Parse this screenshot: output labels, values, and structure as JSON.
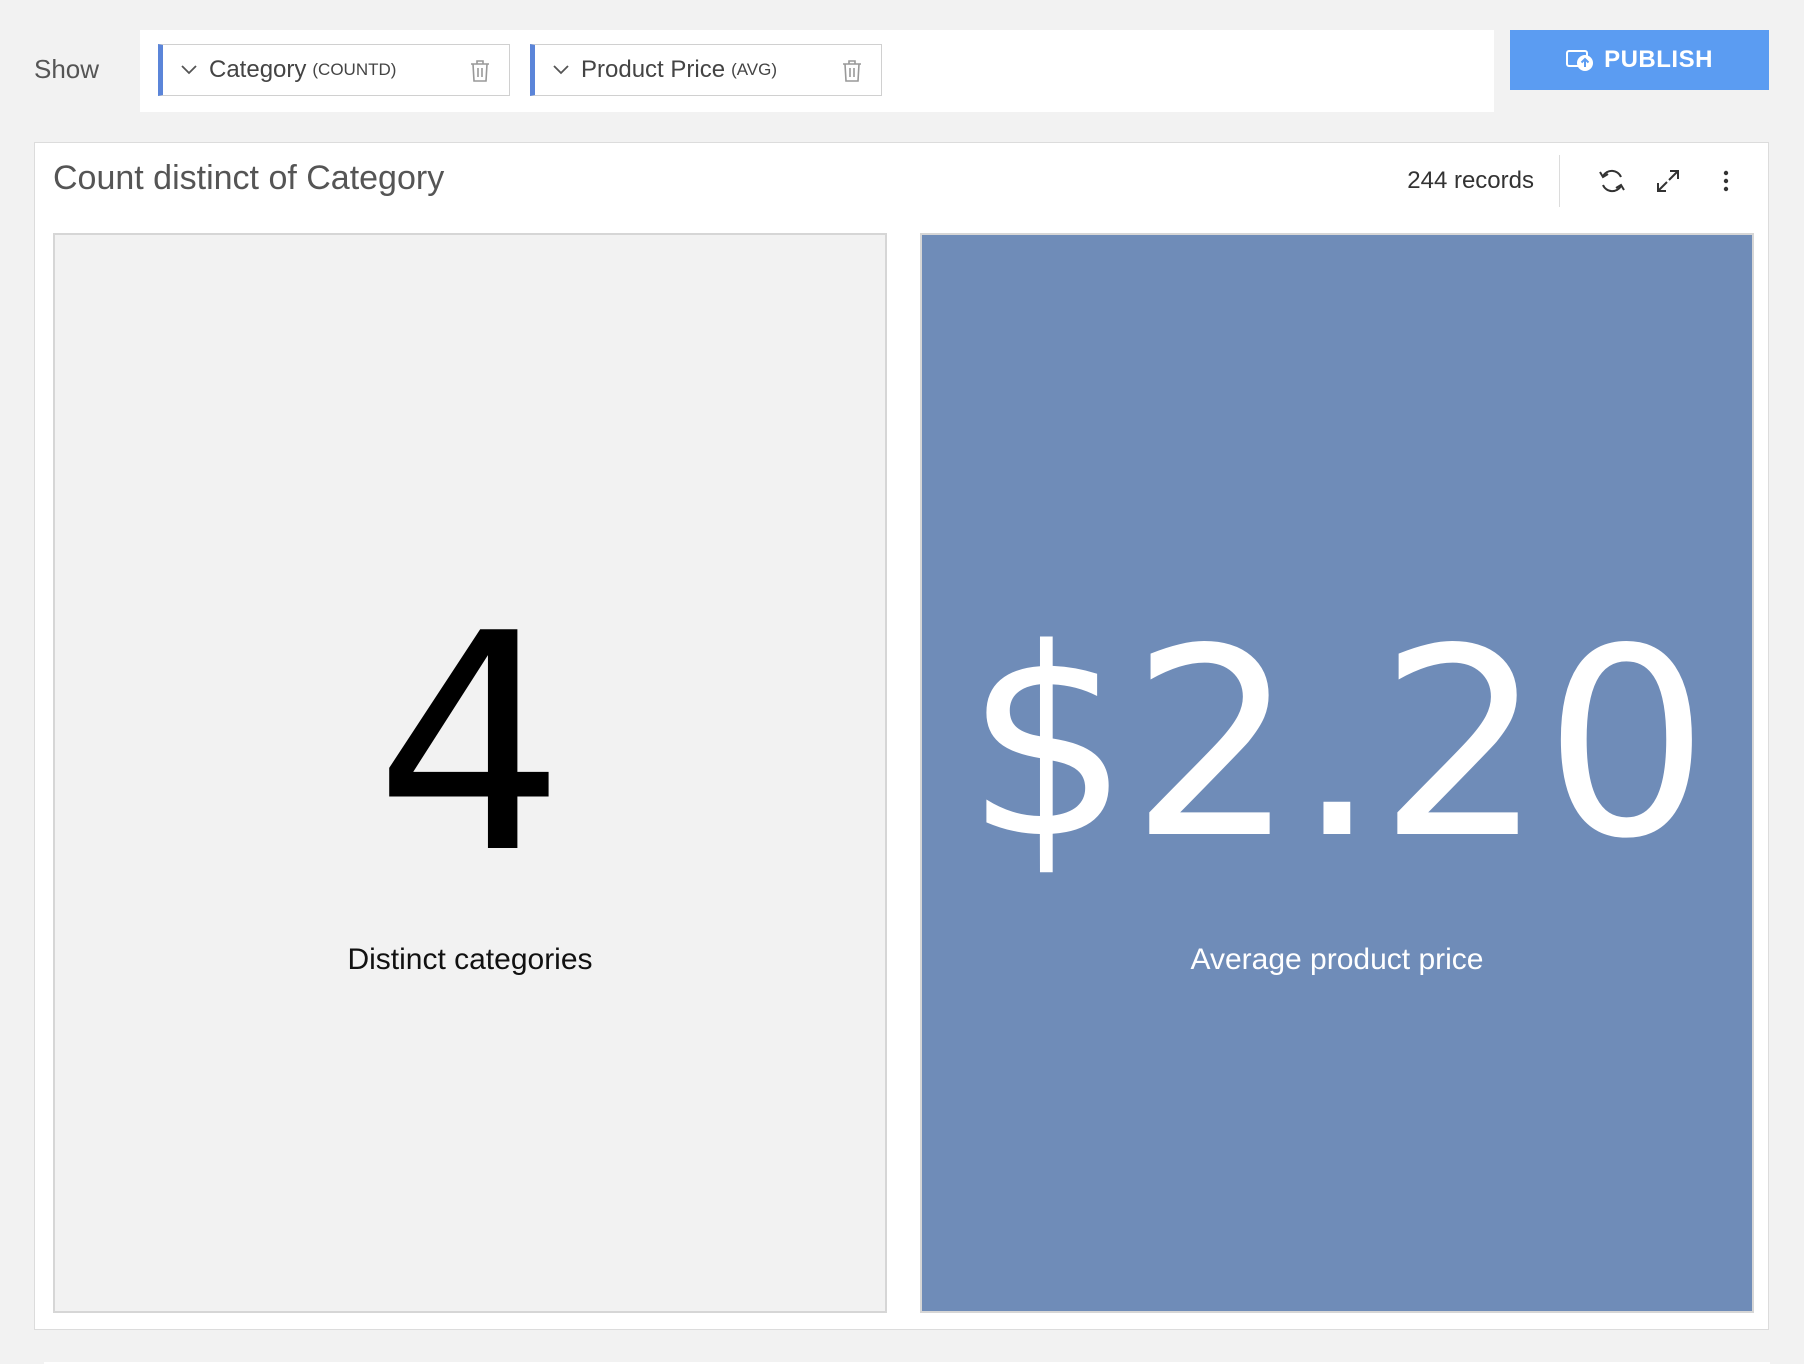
{
  "toolbar": {
    "show_label": "Show",
    "pills": [
      {
        "field": "Category",
        "aggregation": "(COUNTD)"
      },
      {
        "field": "Product Price",
        "aggregation": "(AVG)"
      }
    ],
    "publish_label": "PUBLISH"
  },
  "card": {
    "title": "Count distinct of Category",
    "records": "244 records"
  },
  "tiles": [
    {
      "value": "4",
      "label": "Distinct categories",
      "background": "#f2f2f2"
    },
    {
      "value": "$2.20",
      "label": "Average product price",
      "background": "#6f8cb8"
    }
  ],
  "colors": {
    "accent": "#5b85d9",
    "publish": "#5b9cf2"
  },
  "icons": [
    "chevron-down-icon",
    "trash-icon",
    "publish-icon",
    "refresh-icon",
    "expand-icon",
    "kebab-menu-icon"
  ]
}
